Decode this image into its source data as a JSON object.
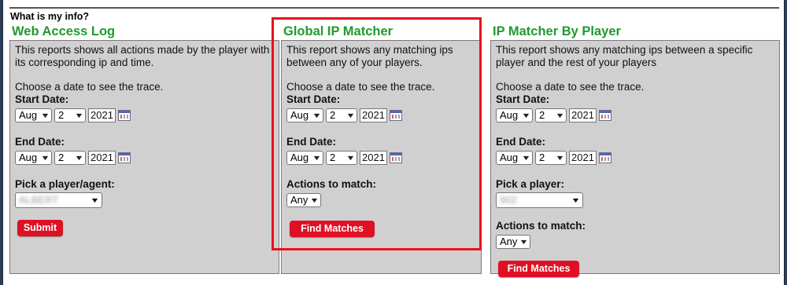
{
  "intro": "What is my info?",
  "columns": [
    {
      "title": "Web Access Log",
      "description": "This reports shows all actions made by the player with its corresponding ip and time.",
      "choose_text": "Choose a date to see the trace.",
      "start_label": "Start Date:",
      "end_label": "End Date:",
      "start": {
        "month": "Aug",
        "day": "2",
        "year": "2021"
      },
      "end": {
        "month": "Aug",
        "day": "2",
        "year": "2021"
      },
      "player_label": "Pick a player/agent:",
      "player_value": "ALBERT",
      "button": "Submit"
    },
    {
      "title": "Global IP Matcher",
      "description": "This report shows any matching ips between any of your players.",
      "choose_text": "Choose a date to see the trace.",
      "start_label": "Start Date:",
      "end_label": "End Date:",
      "start": {
        "month": "Aug",
        "day": "2",
        "year": "2021"
      },
      "end": {
        "month": "Aug",
        "day": "2",
        "year": "2021"
      },
      "actions_label": "Actions to match:",
      "actions_value": "Any",
      "button": "Find Matches"
    },
    {
      "title": "IP Matcher By Player",
      "description": "This report shows any matching ips between a specific player and the rest of your players",
      "choose_text": "Choose a date to see the trace.",
      "start_label": "Start Date:",
      "end_label": "End Date:",
      "start": {
        "month": "Aug",
        "day": "2",
        "year": "2021"
      },
      "end": {
        "month": "Aug",
        "day": "2",
        "year": "2021"
      },
      "player_label": "Pick a player:",
      "player_value": "902",
      "actions_label": "Actions to match:",
      "actions_value": "Any",
      "button": "Find Matches"
    }
  ],
  "colors": {
    "title": "#1f9a2e",
    "button": "#e01024",
    "highlight": "#e8101e",
    "panel": "#d0d0d0"
  },
  "icons": {
    "calendar": "calendar-icon",
    "dropdown": "chevron-down-icon"
  }
}
